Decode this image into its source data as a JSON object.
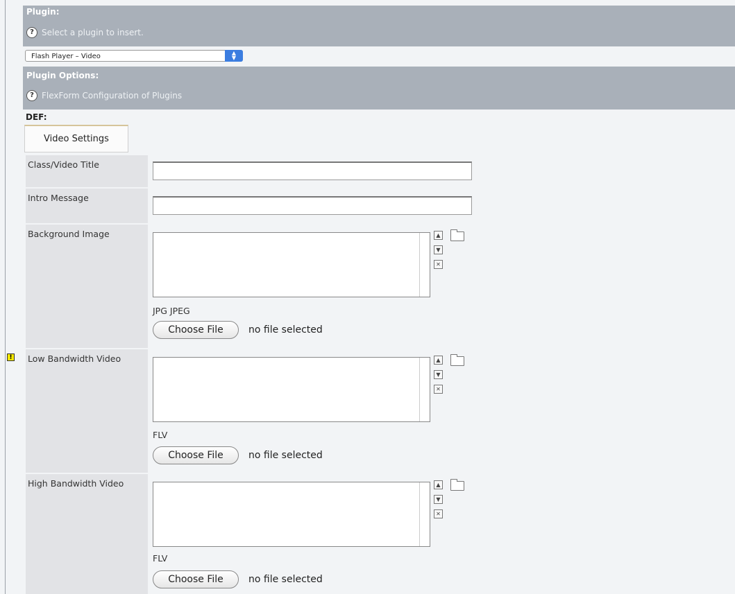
{
  "plugin": {
    "title": "Plugin:",
    "help": "Select a plugin to insert.",
    "selected": "Flash Player – Video"
  },
  "plugin_options": {
    "title": "Plugin Options:",
    "help": "FlexForm Configuration of Plugins"
  },
  "def_label": "DEF:",
  "tab_label": "Video Settings",
  "fields": {
    "title": {
      "label": "Class/Video Title",
      "value": ""
    },
    "intro": {
      "label": "Intro Message",
      "value": ""
    },
    "bg_image": {
      "label": "Background Image",
      "types": "JPG JPEG",
      "button": "Choose File",
      "status": "no file selected"
    },
    "low_video": {
      "label": "Low Bandwidth Video",
      "types": "FLV",
      "button": "Choose File",
      "status": "no file selected"
    },
    "high_video": {
      "label": "High Bandwidth Video",
      "types": "FLV",
      "button": "Choose File",
      "status": "no file selected"
    }
  },
  "icons": {
    "help": "help-icon",
    "warning": "warning-icon",
    "move_up": "move-up-icon",
    "move_down": "move-down-icon",
    "remove": "remove-icon",
    "browse": "folder-icon"
  },
  "colors": {
    "header_bg": "#a9b0b9",
    "label_bg": "#e2e3e6",
    "warning": "#f6e900"
  }
}
